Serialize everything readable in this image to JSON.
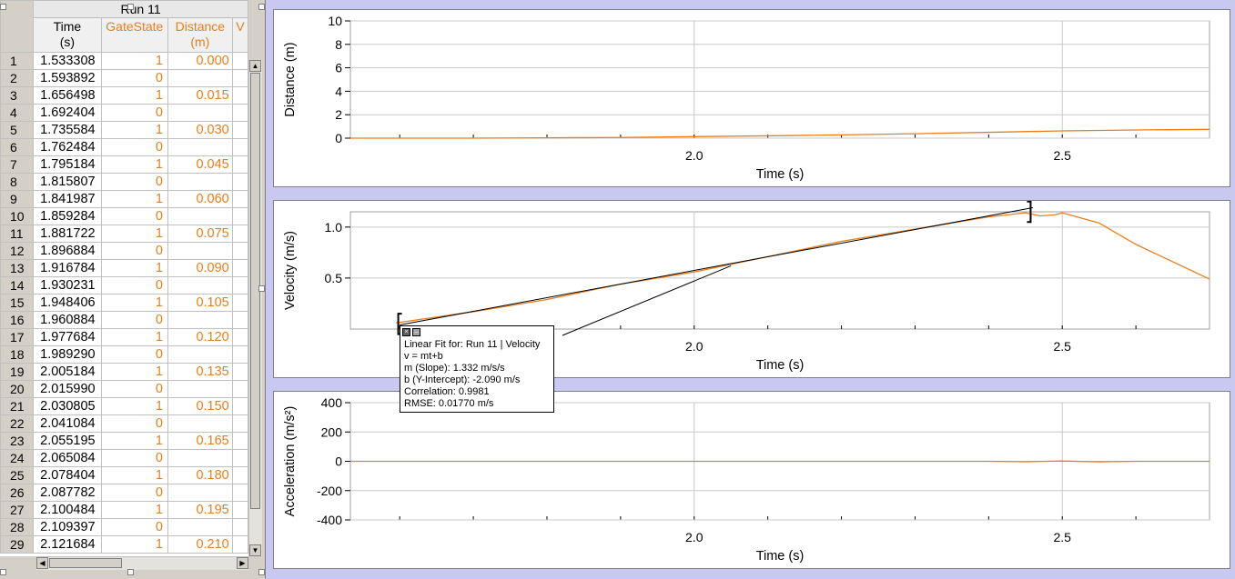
{
  "table": {
    "run_label": "Run 11",
    "columns": [
      {
        "line1": "Time",
        "line2": "(s)",
        "color": "#000000"
      },
      {
        "line1": "GateState",
        "line2": "",
        "color": "#e87e1e"
      },
      {
        "line1": "Distance",
        "line2": "(m)",
        "color": "#e87e1e"
      },
      {
        "line1": "V",
        "line2": "",
        "color": "#e87e1e"
      }
    ],
    "rows": [
      {
        "n": "1",
        "time": "1.533308",
        "gate": "1",
        "dist": "0.000"
      },
      {
        "n": "2",
        "time": "1.593892",
        "gate": "0",
        "dist": ""
      },
      {
        "n": "3",
        "time": "1.656498",
        "gate": "1",
        "dist": "0.015"
      },
      {
        "n": "4",
        "time": "1.692404",
        "gate": "0",
        "dist": ""
      },
      {
        "n": "5",
        "time": "1.735584",
        "gate": "1",
        "dist": "0.030"
      },
      {
        "n": "6",
        "time": "1.762484",
        "gate": "0",
        "dist": ""
      },
      {
        "n": "7",
        "time": "1.795184",
        "gate": "1",
        "dist": "0.045"
      },
      {
        "n": "8",
        "time": "1.815807",
        "gate": "0",
        "dist": ""
      },
      {
        "n": "9",
        "time": "1.841987",
        "gate": "1",
        "dist": "0.060"
      },
      {
        "n": "10",
        "time": "1.859284",
        "gate": "0",
        "dist": ""
      },
      {
        "n": "11",
        "time": "1.881722",
        "gate": "1",
        "dist": "0.075"
      },
      {
        "n": "12",
        "time": "1.896884",
        "gate": "0",
        "dist": ""
      },
      {
        "n": "13",
        "time": "1.916784",
        "gate": "1",
        "dist": "0.090"
      },
      {
        "n": "14",
        "time": "1.930231",
        "gate": "0",
        "dist": ""
      },
      {
        "n": "15",
        "time": "1.948406",
        "gate": "1",
        "dist": "0.105"
      },
      {
        "n": "16",
        "time": "1.960884",
        "gate": "0",
        "dist": ""
      },
      {
        "n": "17",
        "time": "1.977684",
        "gate": "1",
        "dist": "0.120"
      },
      {
        "n": "18",
        "time": "1.989290",
        "gate": "0",
        "dist": ""
      },
      {
        "n": "19",
        "time": "2.005184",
        "gate": "1",
        "dist": "0.135"
      },
      {
        "n": "20",
        "time": "2.015990",
        "gate": "0",
        "dist": ""
      },
      {
        "n": "21",
        "time": "2.030805",
        "gate": "1",
        "dist": "0.150"
      },
      {
        "n": "22",
        "time": "2.041084",
        "gate": "0",
        "dist": ""
      },
      {
        "n": "23",
        "time": "2.055195",
        "gate": "1",
        "dist": "0.165"
      },
      {
        "n": "24",
        "time": "2.065084",
        "gate": "0",
        "dist": ""
      },
      {
        "n": "25",
        "time": "2.078404",
        "gate": "1",
        "dist": "0.180"
      },
      {
        "n": "26",
        "time": "2.087782",
        "gate": "0",
        "dist": ""
      },
      {
        "n": "27",
        "time": "2.100484",
        "gate": "1",
        "dist": "0.195"
      },
      {
        "n": "28",
        "time": "2.109397",
        "gate": "0",
        "dist": ""
      },
      {
        "n": "29",
        "time": "2.121684",
        "gate": "1",
        "dist": "0.210"
      }
    ],
    "scroll_up_icon": "triangle-up",
    "scroll_down_icon": "triangle-down",
    "scroll_left_icon": "triangle-left",
    "scroll_right_icon": "triangle-right"
  },
  "graphs": {
    "x_label": "Time (s)",
    "x_ticks": [
      "2.0",
      "2.5"
    ],
    "data_color": "#e87e1e",
    "background": "#c8c8f0"
  },
  "fit_annotation": {
    "line1": "Linear Fit for: Run 11 | Velocity",
    "line2": "v = mt+b",
    "line3": "m (Slope): 1.332 m/s/s",
    "line4": "b (Y-Intercept): -2.090 m/s",
    "line5": "Correlation: 0.9981",
    "line6": "RMSE: 0.01770 m/s",
    "close_icon": "close-icon",
    "minimize_icon": "minimize-icon"
  },
  "chart_data": [
    {
      "type": "line",
      "ylabel": "Distance (m)",
      "xlabel": "Time (s)",
      "xlim": [
        1.533,
        2.7
      ],
      "ylim": [
        0,
        10
      ],
      "y_ticks": [
        0,
        2,
        4,
        6,
        8,
        10
      ],
      "x_ticks": [
        2.0,
        2.5
      ],
      "grid": true,
      "series": [
        {
          "x": [
            1.533,
            1.7,
            1.9,
            2.0,
            2.1,
            2.2,
            2.3,
            2.4,
            2.5,
            2.6,
            2.7
          ],
          "y": [
            0.0,
            0.0,
            0.06,
            0.13,
            0.2,
            0.28,
            0.38,
            0.5,
            0.62,
            0.7,
            0.75
          ]
        }
      ]
    },
    {
      "type": "line",
      "ylabel": "Velocity (m/s)",
      "xlabel": "Time (s)",
      "xlim": [
        1.533,
        2.7
      ],
      "ylim": [
        0,
        1.15
      ],
      "y_ticks": [
        0.5,
        1.0
      ],
      "x_ticks": [
        2.0,
        2.5
      ],
      "grid": true,
      "series": [
        {
          "x": [
            1.595,
            1.7,
            1.8,
            1.9,
            2.0,
            2.1,
            2.2,
            2.3,
            2.4,
            2.45,
            2.47,
            2.49,
            2.5,
            2.52,
            2.55,
            2.6,
            2.65,
            2.7
          ],
          "y": [
            0.06,
            0.17,
            0.29,
            0.44,
            0.56,
            0.71,
            0.86,
            0.98,
            1.1,
            1.14,
            1.11,
            1.12,
            1.14,
            1.1,
            1.04,
            0.83,
            0.66,
            0.49
          ]
        },
        {
          "name": "Linear Fit",
          "x": [
            1.6,
            2.46
          ],
          "y": [
            0.04,
            1.19
          ]
        }
      ]
    },
    {
      "type": "line",
      "ylabel": "Acceleration (m/s²)",
      "xlabel": "Time (s)",
      "xlim": [
        1.533,
        2.7
      ],
      "ylim": [
        -400,
        400
      ],
      "y_ticks": [
        -400,
        -200,
        0,
        200,
        400
      ],
      "x_ticks": [
        2.0,
        2.5
      ],
      "grid": true,
      "series": [
        {
          "x": [
            1.533,
            2.0,
            2.4,
            2.45,
            2.5,
            2.55,
            2.6,
            2.7
          ],
          "y": [
            0,
            0,
            0,
            -3,
            2,
            -4,
            0,
            0
          ]
        }
      ]
    }
  ]
}
